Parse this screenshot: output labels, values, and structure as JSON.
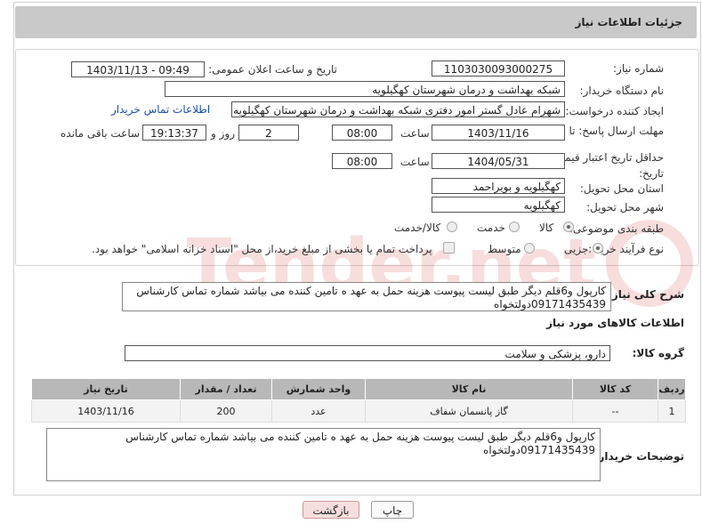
{
  "page": {
    "title": "جزئیات اطلاعات نیاز"
  },
  "form": {
    "need_number": {
      "label": "شماره نیاز:",
      "value": "1103030093000275"
    },
    "announce": {
      "label": "تاریخ و ساعت اعلان عمومی:",
      "value": "1403/11/13 - 09:49"
    },
    "buyer": {
      "label": "نام دستگاه خریدار:",
      "value": "شبکه بهداشت و درمان شهرستان کهگیلویه"
    },
    "creator": {
      "label": "ایجاد کننده درخواست:",
      "value": "شهرام عادل گستر امور دفتری شبکه بهداشت و درمان شهرستان کهگیلویه",
      "contact_link": "اطلاعات تماس خریدار"
    },
    "deadline": {
      "label": "مهلت ارسال پاسخ: تا تاریخ:",
      "date": "1403/11/16",
      "time_label": "ساعت",
      "time": "08:00",
      "days": "2",
      "days_label": "روز و",
      "remaining": "19:13:37",
      "remaining_label": "ساعت باقی مانده"
    },
    "validity": {
      "label": "حداقل تاریخ اعتبار قیمت: تا تاریخ:",
      "date": "1404/05/31",
      "time_label": "ساعت",
      "time": "08:00"
    },
    "province": {
      "label": "استان محل تحویل:",
      "value": "کهگیلویه و بویراحمد"
    },
    "city": {
      "label": "شهر محل تحویل:",
      "value": "کهگیلویه"
    },
    "category": {
      "label": "طبقه بندی موضوعی:",
      "options": [
        "کالا",
        "خدمت",
        "کالا/خدمت"
      ],
      "selected": "کالا"
    },
    "process": {
      "label": "نوع فرآیند خرید :",
      "options": [
        "جزیی",
        "متوسط"
      ],
      "selected": "جزیی",
      "note": "پرداخت تمام یا بخشی از مبلغ خرید،از محل \"اسناد خزانه اسلامی\" خواهد بود."
    }
  },
  "summary": {
    "label": "شرح کلی نیاز:",
    "text": "کارپول و6قلم دیگر طبق لیست پیوست هزینه حمل به عهد ه تامین کننده می بیاشد شماره تماس کارشناس 09171435439دولتخواه"
  },
  "goods_info": {
    "title": "اطلاعات کالاهای مورد نیاز",
    "group_label": "گروه کالا:",
    "group_value": "دارو، پزشکی و سلامت"
  },
  "table": {
    "headers": [
      "ردیف",
      "کد کالا",
      "نام کالا",
      "واحد شمارش",
      "تعداد / مقدار",
      "تاریخ نیاز"
    ],
    "rows": [
      [
        "1",
        "--",
        "گاز پانسمان شفاف",
        "عدد",
        "200",
        "1403/11/16"
      ]
    ]
  },
  "buyer_notes": {
    "label": "توضیحات خریدار:",
    "text": "کارپول و6قلم دیگر طبق لیست پیوست هزینه حمل به عهد ه تامین کننده می بیاشد شماره تماس کارشناس 09171435439دولتخواه"
  },
  "buttons": {
    "print": "چاپ",
    "back": "بازگشت"
  },
  "watermark": {
    "text": "AriaTender.net"
  },
  "colors": {
    "link": "#1a4fb3",
    "back_button": "#f7dede",
    "header_bg": "#c9c9c9"
  }
}
